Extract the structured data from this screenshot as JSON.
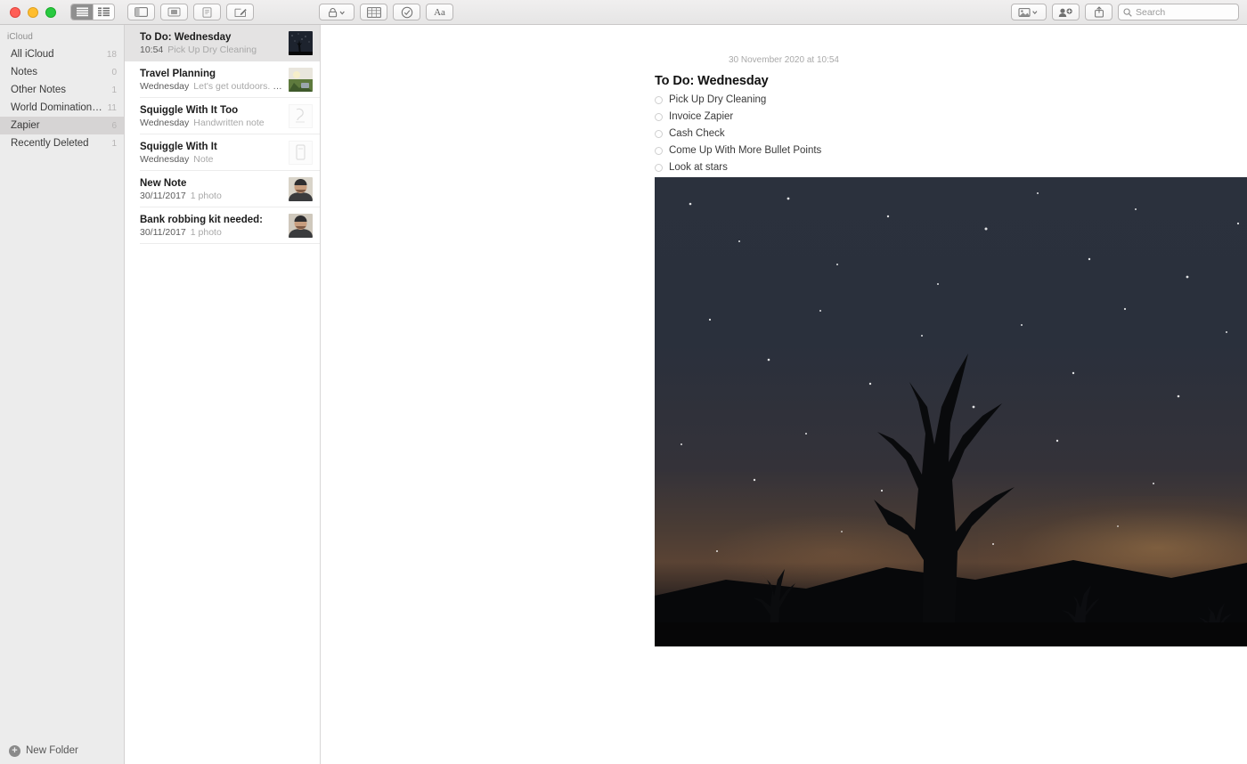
{
  "window": {
    "traffic_lights": [
      "close",
      "minimize",
      "zoom"
    ],
    "view_toggle": {
      "list_label": "list-view",
      "grid_label": "grid-view",
      "selected": "list-view"
    }
  },
  "toolbar": {
    "nav_buttons": [
      {
        "name": "toggle-sidebar-button",
        "icon": "sidebar-icon"
      },
      {
        "name": "delete-note-button",
        "icon": "trash-icon"
      },
      {
        "name": "move-note-button",
        "icon": "folder-move-icon"
      },
      {
        "name": "compose-note-button",
        "icon": "compose-icon"
      }
    ],
    "format_buttons": [
      {
        "name": "lock-note-button",
        "icon": "lock-icon",
        "has_menu": true
      },
      {
        "name": "insert-table-button",
        "icon": "table-icon"
      },
      {
        "name": "checklist-button",
        "icon": "checklist-icon"
      },
      {
        "name": "format-button",
        "icon": "aa-icon",
        "label": "Aa"
      }
    ],
    "right_buttons": [
      {
        "name": "media-button",
        "icon": "media-icon",
        "has_menu": true
      },
      {
        "name": "add-people-button",
        "icon": "add-people-icon"
      },
      {
        "name": "share-button",
        "icon": "share-icon"
      }
    ],
    "search": {
      "placeholder": "Search",
      "value": "",
      "icon": "search-icon"
    }
  },
  "sidebar": {
    "section_title": "iCloud",
    "items": [
      {
        "label": "All iCloud",
        "count": "18",
        "active": false
      },
      {
        "label": "Notes",
        "count": "0",
        "active": false
      },
      {
        "label": "Other Notes",
        "count": "1",
        "active": false
      },
      {
        "label": "World Domination Pl…",
        "count": "11",
        "active": false
      },
      {
        "label": "Zapier",
        "count": "6",
        "active": true
      },
      {
        "label": "Recently Deleted",
        "count": "1",
        "active": false
      }
    ],
    "new_folder_label": "New Folder"
  },
  "note_list": [
    {
      "title": "To Do: Wednesday",
      "date": "10:54",
      "snippet": "Pick Up Dry Cleaning",
      "thumb": "night-sky-photo",
      "selected": true
    },
    {
      "title": "Travel Planning",
      "date": "Wednesday",
      "snippet": "Let's get outdoors. Ide…",
      "thumb": "outdoor-photo",
      "selected": false
    },
    {
      "title": "Squiggle With It Too",
      "date": "Wednesday",
      "snippet": "Handwritten note",
      "thumb": "sketch-thumb",
      "selected": false
    },
    {
      "title": "Squiggle With It",
      "date": "Wednesday",
      "snippet": "Note",
      "thumb": "sketch-thumb-2",
      "selected": false
    },
    {
      "title": "New Note",
      "date": "30/11/2017",
      "snippet": "1 photo",
      "thumb": "portrait-photo",
      "selected": false
    },
    {
      "title": "Bank robbing kit needed:",
      "date": "30/11/2017",
      "snippet": "1 photo",
      "thumb": "portrait-photo",
      "selected": false
    }
  ],
  "editor": {
    "timestamp": "30 November 2020 at 10:54",
    "title": "To Do: Wednesday",
    "checklist": [
      {
        "label": "Pick Up Dry Cleaning",
        "checked": false
      },
      {
        "label": "Invoice Zapier",
        "checked": false
      },
      {
        "label": "Cash Check",
        "checked": false
      },
      {
        "label": "Come Up With More Bullet Points",
        "checked": false
      },
      {
        "label": "Look at stars",
        "checked": false
      }
    ],
    "attachment": {
      "name": "joshua-tree-night-sky-photo",
      "menu_icon": "chevron-down-icon"
    }
  },
  "colors": {
    "toolbar_bg": "#eceaea",
    "sidebar_bg": "#ececec",
    "selection_bg": "#e4e3e3",
    "sidebar_selection_bg": "#d6d4d4",
    "sky": "#2a303c",
    "horizon_glow": "#a8703c"
  }
}
